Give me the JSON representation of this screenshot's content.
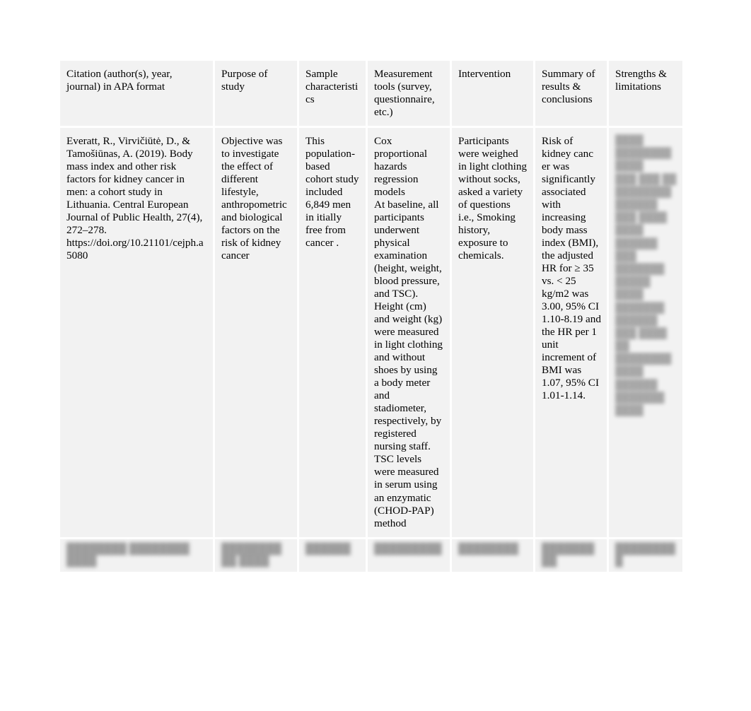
{
  "document": {
    "type": "literature-review-matrix-table",
    "background_color": "#ffffff",
    "cell_background_color": "#f2f2f2",
    "gridline_color": "#ffffff"
  },
  "table": {
    "columns": [
      {
        "key": "citation",
        "header": "Citation (author(s), year, journal) in APA format"
      },
      {
        "key": "purpose",
        "header": "Purpose of study"
      },
      {
        "key": "sample",
        "header": "Sample characteristics"
      },
      {
        "key": "measurement",
        "header": "Measurement tools (survey, questionnaire, etc.)"
      },
      {
        "key": "intervention",
        "header": "Intervention"
      },
      {
        "key": "summary",
        "header": "Summary of results & conclusions"
      },
      {
        "key": "strengths",
        "header": "Strengths & limitations"
      }
    ],
    "header": {
      "citation": "Citation (author(s), year, journal) in APA format",
      "purpose": "Purpose of study",
      "sample": "Sample characteristi cs",
      "measurement": "Measurement tools (survey, questionnaire, etc.)",
      "intervention": "Intervention",
      "summary": "Summary of results & conclusions",
      "strengths": "Strengths & limitations"
    },
    "rows": [
      {
        "citation": "Everatt, R., Virvičiūtė, D., & Tamošiūnas, A. (2019). Body mass index and other risk factors for kidney cancer in men: a cohort study in Lithuania. Central European Journal of Public Health, 27(4), 272–278. https://doi.org/10.21101/cejph.a5080",
        "purpose": "Objective was to investigate the effect of different lifestyle, anthropometric and biological factors on the risk of kidney cancer",
        "sample": "This population-based cohort study included 6,849 men in itially free from cancer .",
        "measurement": "Cox proportional hazards regression models\nAt baseline, all participants underwent physical examination (height, weight, blood pressure, and TSC). Height (cm) and weight (kg) were measured in light clothing and without shoes by using a body meter and stadiometer, respectively, by registered nursing staff. TSC levels were measured in serum using an enzymatic (CHOD-PAP) method",
        "intervention": "Participants were weighed in light clothing without socks, asked a variety of questions i.e., Smoking history, exposure to chemicals.",
        "summary": "Risk of kidney canc er was significantly associated with increasing body mass index (BMI), the adjusted HR for ≥ 35 vs. < 25 kg/m2 was 3.00, 95% CI 1.10-8.19 and the HR per 1 unit increment of BMI was 1.07, 95% CI 1.01-1.14.",
        "strengths": "████ ████████ ████\n███ ███ ██\n████████ ██████\n███ ████ ████\n██████ ███\n███████ █████\n████ ███████\n██████ ███ ████\n██ ████████\n████ ██████\n███████ ████",
        "strengths_legible": false
      }
    ],
    "footer_row": {
      "citation": "████████ ████████ ████",
      "purpose": "████████ ██ ████",
      "sample": "██████",
      "measurement": "█████████",
      "intervention": "████████",
      "summary": "███████ ██",
      "strengths": "█████████",
      "legible": false
    }
  }
}
